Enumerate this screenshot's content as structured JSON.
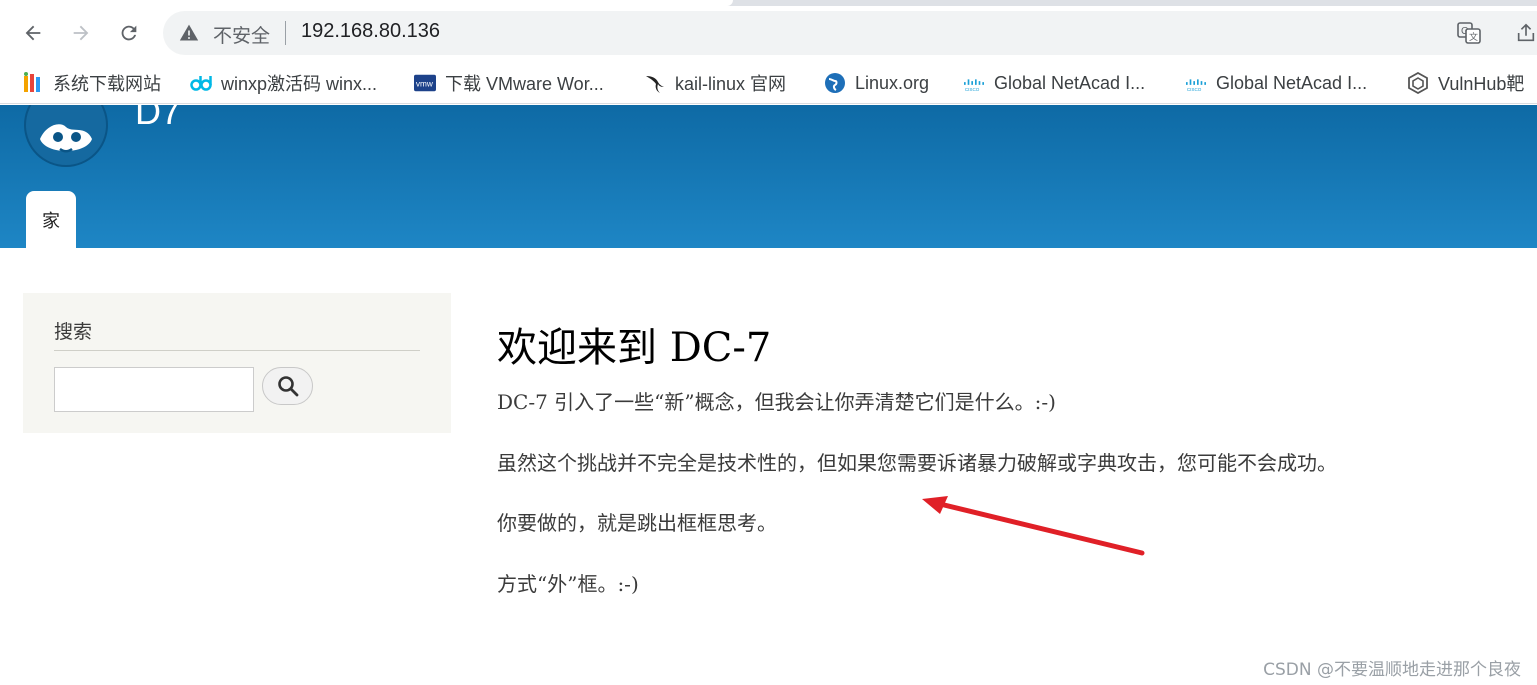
{
  "browser": {
    "security_label": "不安全",
    "url": "192.168.80.136",
    "bookmarks": [
      {
        "label": "系统下载网站",
        "icon": "colorful-logo-icon"
      },
      {
        "label": "winxp激活码 winx...",
        "icon": "dd-icon"
      },
      {
        "label": "下载 VMware Wor...",
        "icon": "vmw-icon"
      },
      {
        "label": "kail-linux 官网",
        "icon": "kali-dragon-icon"
      },
      {
        "label": "Linux.org",
        "icon": "globe-icon"
      },
      {
        "label": "Global NetAcad I...",
        "icon": "cisco-icon"
      },
      {
        "label": "Global NetAcad I...",
        "icon": "cisco-icon"
      },
      {
        "label": "VulnHub靶",
        "icon": "vulnhub-icon"
      }
    ]
  },
  "site": {
    "name": "D7",
    "nav_tab": "家",
    "brand_color": "#1a7dbd"
  },
  "sidebar": {
    "title": "搜索",
    "search_value": ""
  },
  "content": {
    "title": "欢迎来到 DC-7",
    "paragraphs": [
      "DC-7 引入了一些“新”概念，但我会让你弄清楚它们是什么。:-)",
      "虽然这个挑战并不完全是技术性的，但如果您需要诉诸暴力破解或字典攻击，您可能不会成功。",
      "你要做的，就是跳出框框思考。",
      "方式“外”框。:-)"
    ]
  },
  "annotation_color": "#e02027",
  "watermark": "CSDN @不要温顺地走进那个良夜"
}
